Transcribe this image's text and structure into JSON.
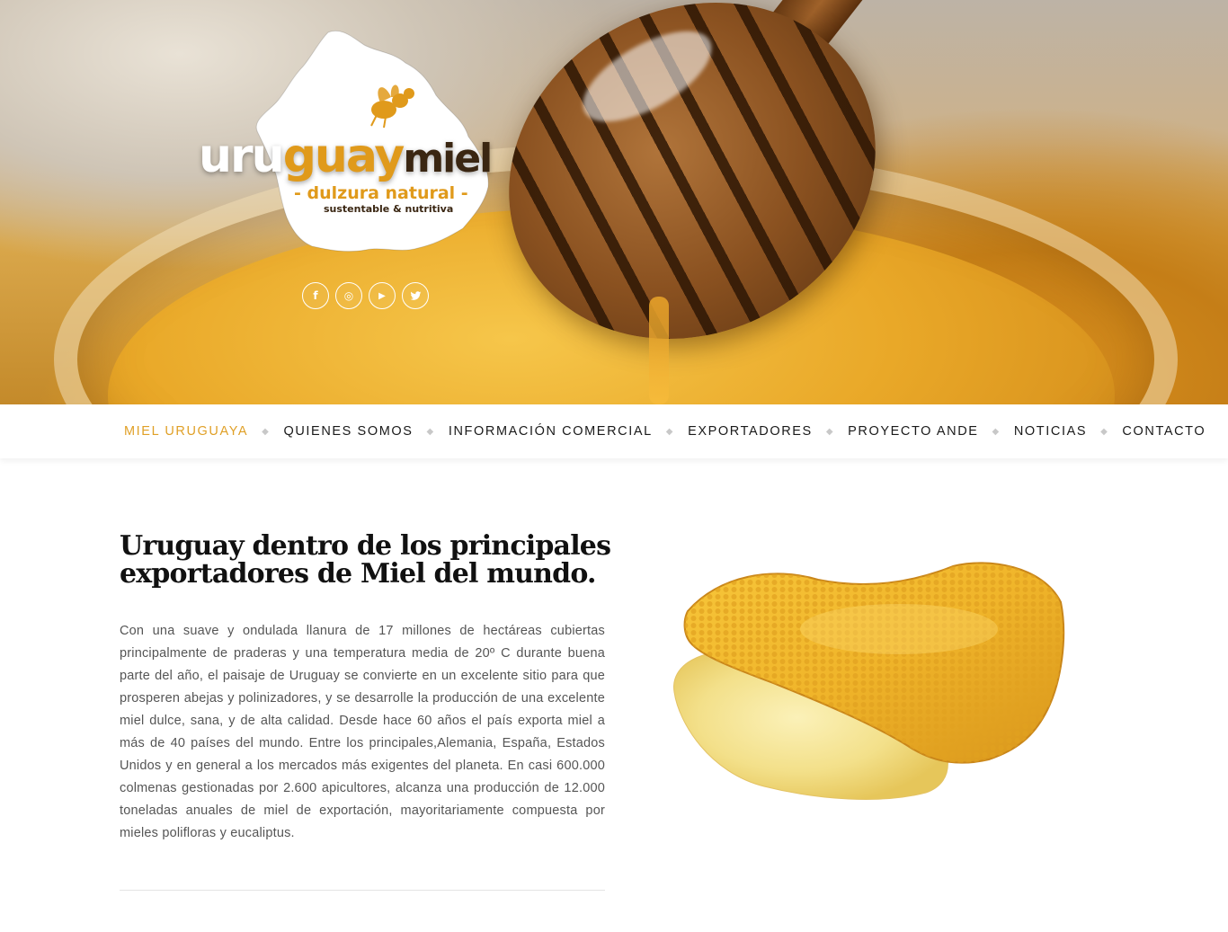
{
  "brand": {
    "word_white": "uru",
    "word_gold": "guay",
    "word_dark": "miel",
    "tagline": "- dulzura natural -",
    "subtagline": "sustentable & nutritiva"
  },
  "social": [
    {
      "name": "facebook-icon",
      "glyph": "f"
    },
    {
      "name": "instagram-icon",
      "glyph": "◎"
    },
    {
      "name": "youtube-icon",
      "glyph": "▶"
    },
    {
      "name": "twitter-icon",
      "glyph": "✓"
    }
  ],
  "nav": {
    "items": [
      {
        "label": "MIEL URUGUAYA",
        "active": true
      },
      {
        "label": "QUIENES SOMOS",
        "active": false
      },
      {
        "label": "INFORMACIÓN COMERCIAL",
        "active": false
      },
      {
        "label": "EXPORTADORES",
        "active": false
      },
      {
        "label": "PROYECTO ANDE",
        "active": false
      },
      {
        "label": "NOTICIAS",
        "active": false
      },
      {
        "label": "CONTACTO",
        "active": false
      }
    ],
    "separator": "◆"
  },
  "article": {
    "title_line1": "Uruguay dentro de los principales",
    "title_line2": "exportadores de Miel del mundo.",
    "body": "Con una suave y ondulada llanura de 17 millones de hectáreas cubiertas principalmente de praderas y una temperatura media de 20º C durante buena parte del año, el paisaje de Uruguay se convierte en un excelente sitio para que prosperen abejas y polinizadores, y se desarrolle la producción de una excelente miel dulce, sana, y de alta calidad. Desde hace 60 años el país exporta miel a más de 40 países del mundo. Entre los principales,Alemania, España, Estados Unidos y en general a los mercados más exigentes del planeta. En casi 600.000 colmenas gestionadas por 2.600 apicultores, alcanza una producción de 12.000 toneladas anuales de miel de exportación, mayoritariamente compuesta por mieles polifloras y eucaliptus."
  },
  "colors": {
    "accent": "#e0a027",
    "honey_dark": "#3a2612",
    "text": "#555555"
  }
}
